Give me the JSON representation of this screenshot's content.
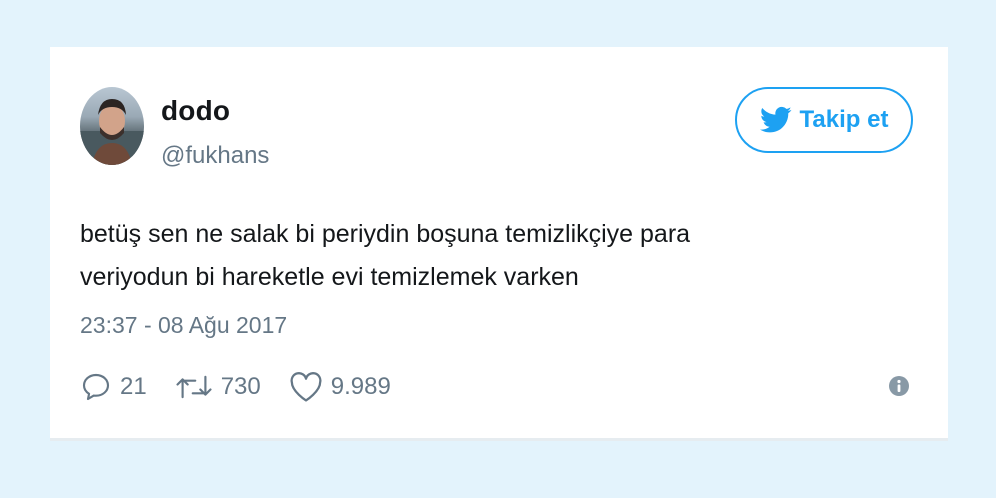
{
  "user": {
    "display_name": "dodo",
    "handle": "@fukhans",
    "avatar_icon": "user-photo"
  },
  "follow_button": {
    "label": "Takip et",
    "icon": "twitter-bird-icon",
    "color": "#1da1f2"
  },
  "tweet": {
    "text_line1": "betüş sen ne salak bi periydin boşuna temizlikçiye para",
    "text_line2": "veriyodun bi hareketle evi temizlemek varken",
    "timestamp": "23:37 - 08 Ağu 2017"
  },
  "actions": {
    "reply_count": "21",
    "retweet_count": "730",
    "like_count": "9.989",
    "reply_icon": "reply-icon",
    "retweet_icon": "retweet-icon",
    "like_icon": "heart-icon",
    "info_icon": "info-icon"
  },
  "colors": {
    "background": "#e3f3fc",
    "card": "#ffffff",
    "muted": "#657786",
    "text": "#14171a"
  }
}
